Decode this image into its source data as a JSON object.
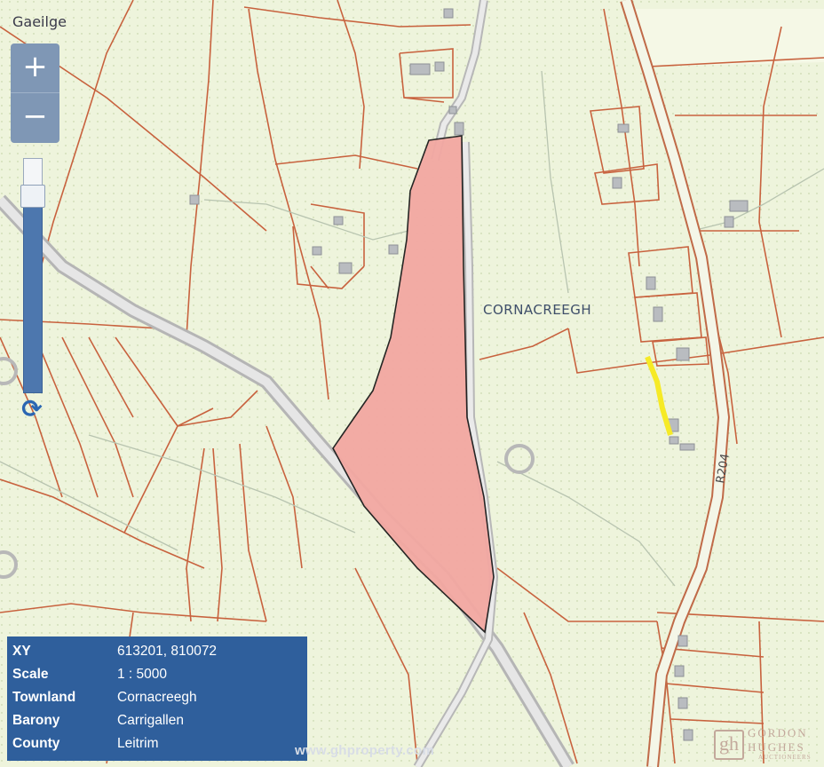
{
  "language_link": "Gaeilge",
  "zoom": {
    "in_label": "+",
    "out_label": "−"
  },
  "refresh_glyph": "⟳",
  "map_labels": {
    "townland": "CORNACREEGH",
    "road": "R204"
  },
  "info": [
    {
      "key": "XY",
      "value": "613201, 810072"
    },
    {
      "key": "Scale",
      "value": "1 : 5000"
    },
    {
      "key": "Townland",
      "value": "Cornacreegh"
    },
    {
      "key": "Barony",
      "value": "Carrigallen"
    },
    {
      "key": "County",
      "value": "Leitrim"
    }
  ],
  "watermark": "www.ghproperty.com",
  "logo": {
    "mark": "gh",
    "line1": "GORDON",
    "line2": "HUGHES",
    "line3": "AUCTIONEERS"
  },
  "colors": {
    "parcel_fill": "#f3a8a2",
    "parcel_stroke": "#1b1b1b",
    "boundary": "#c8623e",
    "background": "#eef4dc",
    "highlight": "#f6ea26",
    "info_bg": "#2f5f9c"
  }
}
